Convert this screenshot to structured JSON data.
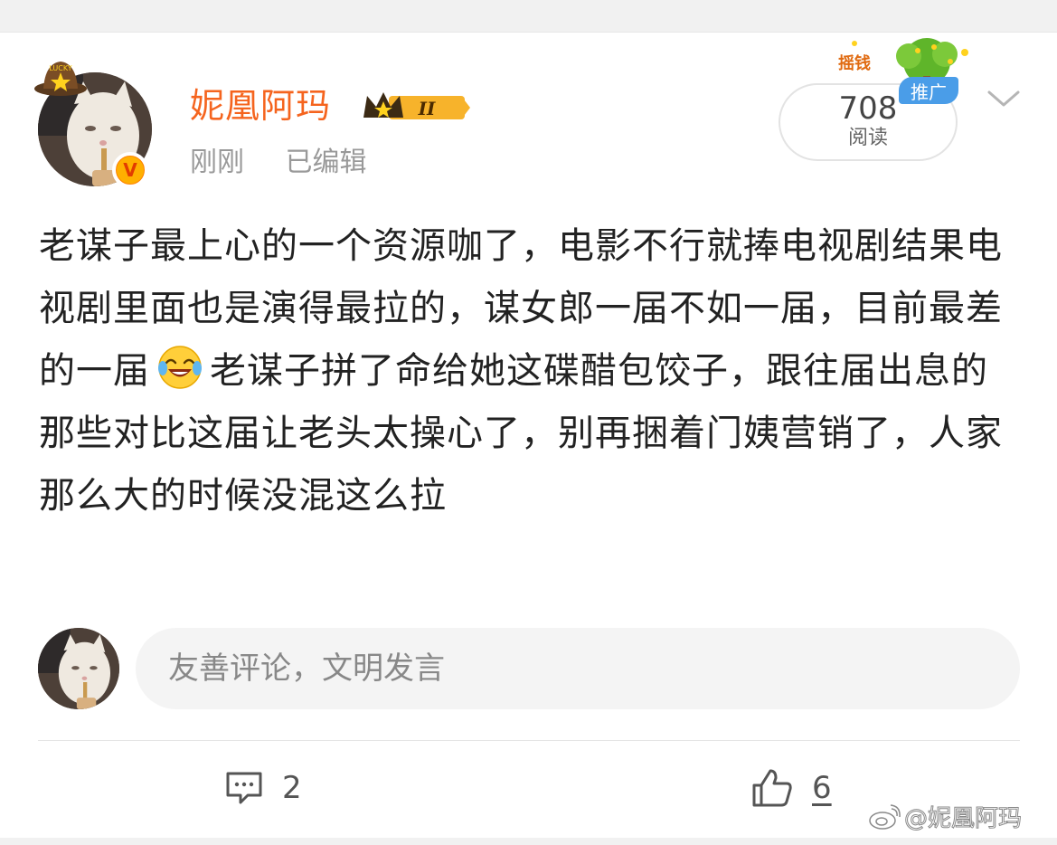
{
  "header": {
    "username": "妮凰阿玛",
    "level_badge": "II",
    "hat_text": "LUCKY",
    "timestamp": "刚刚",
    "edit_status": "已编辑",
    "read_count": "708",
    "read_label": "阅读",
    "promo_tag": "推广",
    "promo_art_text": "摇钱"
  },
  "post": {
    "text_before_emoji": "老谋子最上心的一个资源咖了，电影不行就捧电视剧结果电视剧里面也是演得最拉的，谋女郎一届不如一届，目前最差的一届",
    "emoji": "laughing-crying-icon",
    "text_after_emoji": "老谋子拼了命给她这碟醋包饺子，跟往届出息的那些对比这届让老头太操心了，别再捆着门姨营销了，人家那么大的时候没混这么拉"
  },
  "comment_box": {
    "placeholder": "友善评论，文明发言"
  },
  "actions": {
    "comment_count": "2",
    "like_count": "6"
  },
  "watermark": {
    "text": "@妮凰阿玛"
  },
  "colors": {
    "username": "#f5641e",
    "verified_badge": "#ff8200",
    "promo_tag": "#4a9de8",
    "text": "#222222",
    "muted": "#999999"
  }
}
